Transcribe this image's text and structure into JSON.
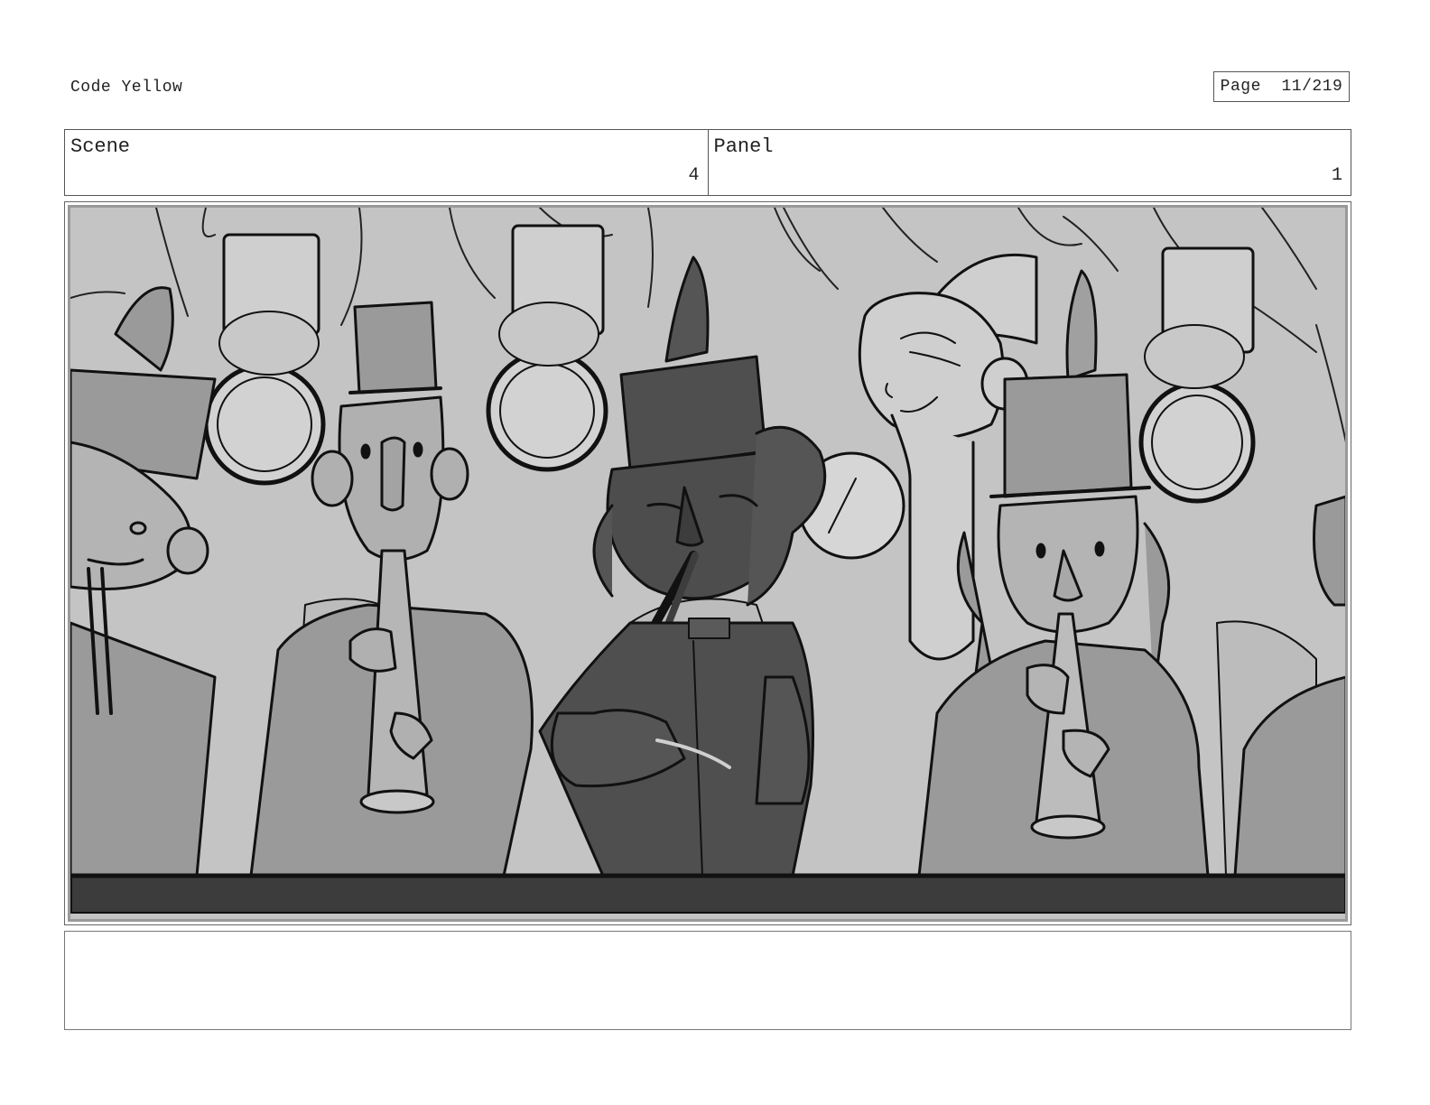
{
  "header": {
    "project_title": "Code Yellow",
    "page_label": "Page",
    "page_number": "11/219"
  },
  "info": {
    "scene_label": "Scene",
    "scene_value": "4",
    "panel_label": "Panel",
    "panel_value": "1"
  },
  "artwork": {
    "description_icon": "storyboard-sketch-marching-band",
    "colors": {
      "background": "#c4c4c4",
      "mid_gray": "#9a9a9a",
      "dark_gray": "#4f4f4f",
      "light_gray": "#d2d2d2",
      "line": "#111111"
    }
  },
  "notes": {
    "text": ""
  }
}
